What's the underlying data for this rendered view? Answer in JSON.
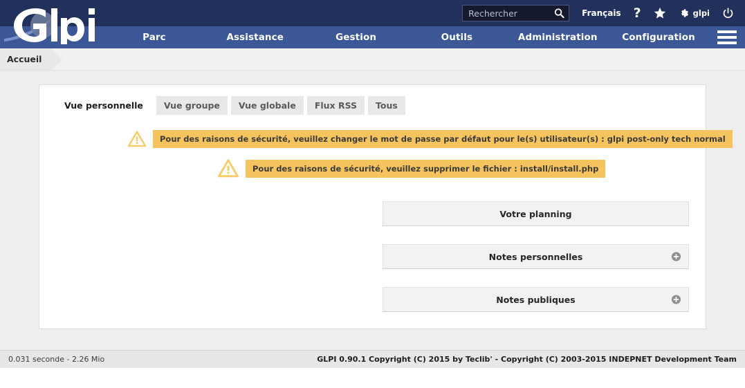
{
  "header": {
    "logo_text": "Glpi",
    "search": {
      "placeholder": "Rechercher",
      "value": "",
      "icon": "search-icon"
    },
    "language": "Français",
    "help_icon": "question-mark-icon",
    "favorites_icon": "star-icon",
    "settings_icon": "gear-icon",
    "user": "glpi",
    "logout_icon": "power-icon",
    "menu_icon": "hamburger-menu-icon"
  },
  "nav": {
    "items": [
      {
        "label": "Parc"
      },
      {
        "label": "Assistance"
      },
      {
        "label": "Gestion"
      },
      {
        "label": "Outils"
      },
      {
        "label": "Administration"
      },
      {
        "label": "Configuration"
      }
    ]
  },
  "breadcrumb": {
    "items": [
      "Accueil"
    ]
  },
  "main": {
    "tabs": [
      {
        "label": "Vue personnelle",
        "active": true
      },
      {
        "label": "Vue groupe",
        "active": false
      },
      {
        "label": "Vue globale",
        "active": false
      },
      {
        "label": "Flux RSS",
        "active": false
      },
      {
        "label": "Tous",
        "active": false
      }
    ],
    "warnings": [
      {
        "icon": "warning-triangle-icon",
        "text": "Pour des raisons de sécurité, veuillez changer le mot de passe par défaut pour le(s) utilisateur(s) : glpi post-only tech normal"
      },
      {
        "icon": "warning-triangle-icon",
        "text": "Pour des raisons de sécurité, veuillez supprimer le fichier : install/install.php"
      }
    ],
    "panels": [
      {
        "label": "Votre planning",
        "expandable": false
      },
      {
        "label": "Notes personnelles",
        "expandable": true,
        "icon": "plus-circle-icon"
      },
      {
        "label": "Notes publiques",
        "expandable": true,
        "icon": "plus-circle-icon"
      }
    ]
  },
  "footer": {
    "performance": "0.031 seconde - 2.26 Mio",
    "copyright": "GLPI 0.90.1 Copyright (C) 2015 by Teclib' - Copyright (C) 2003-2015 INDEPNET Development Team"
  },
  "colors": {
    "header_dark": "#22315c",
    "nav_blue": "#3c5795",
    "warning_amber": "#f5c45e",
    "warning_icon": "#f6cd6b",
    "content_bg": "#eeeeee",
    "panel_bg": "#f2f2f2"
  }
}
